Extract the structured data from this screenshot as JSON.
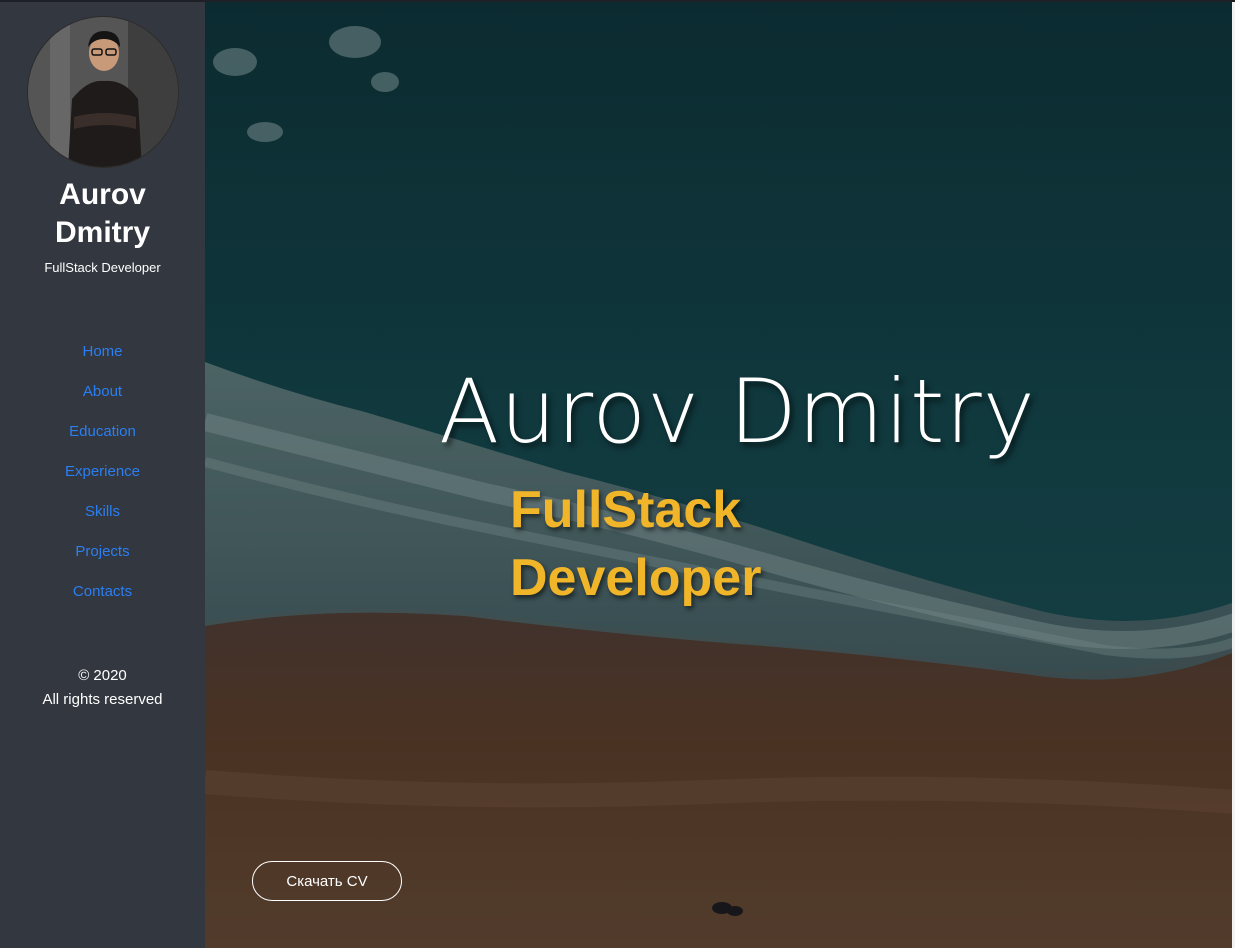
{
  "sidebar": {
    "name": "Aurov Dmitry",
    "role": "FullStack Developer",
    "nav": [
      {
        "label": "Home"
      },
      {
        "label": "About"
      },
      {
        "label": "Education"
      },
      {
        "label": "Experience"
      },
      {
        "label": "Skills"
      },
      {
        "label": "Projects"
      },
      {
        "label": "Contacts"
      }
    ],
    "copyright_year": "© 2020",
    "copyright_text": "All rights reserved"
  },
  "hero": {
    "name": "Aurov Dmitry",
    "role": "FullStack Developer",
    "cv_button": "Скачать CV"
  },
  "colors": {
    "sidebar_bg": "#33373f",
    "nav_link": "#2a7ff3",
    "accent": "#f1b52a",
    "sea": "#0f3b42",
    "sand": "#5a3f2c"
  }
}
